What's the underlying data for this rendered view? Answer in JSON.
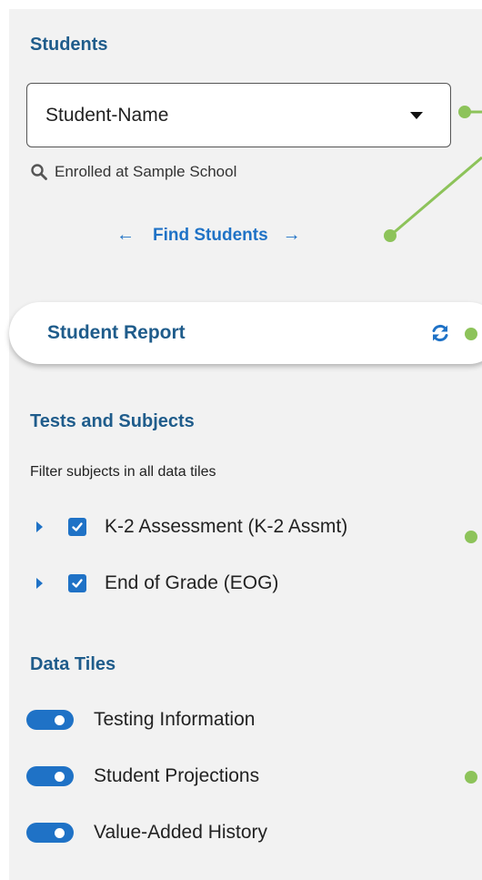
{
  "students": {
    "title": "Students",
    "selected_student": "Student-Name",
    "hint_text": "Enrolled at Sample School",
    "find_label": "Find Students"
  },
  "student_report": {
    "label": "Student Report"
  },
  "tests_and_subjects": {
    "title": "Tests and Subjects",
    "filter_hint": "Filter subjects in all data tiles",
    "items": [
      {
        "label": "K-2 Assessment (K-2 Assmt)",
        "checked": true
      },
      {
        "label": "End of Grade (EOG)",
        "checked": true
      }
    ]
  },
  "data_tiles": {
    "title": "Data Tiles",
    "items": [
      {
        "label": "Testing Information",
        "enabled": true
      },
      {
        "label": "Student Projections",
        "enabled": true
      },
      {
        "label": "Value-Added History",
        "enabled": true
      }
    ]
  },
  "colors": {
    "accent": "#1f72c6",
    "heading": "#1f5c8b",
    "callout": "#8dc35a",
    "panel_bg": "#f2f2f2"
  },
  "icons": {
    "dropdown": "caret-down-icon",
    "search": "magnifier-icon",
    "prev": "arrow-left-icon",
    "next": "arrow-right-icon",
    "refresh": "refresh-icon",
    "expander": "chevron-right-icon",
    "checkbox": "check-icon"
  }
}
